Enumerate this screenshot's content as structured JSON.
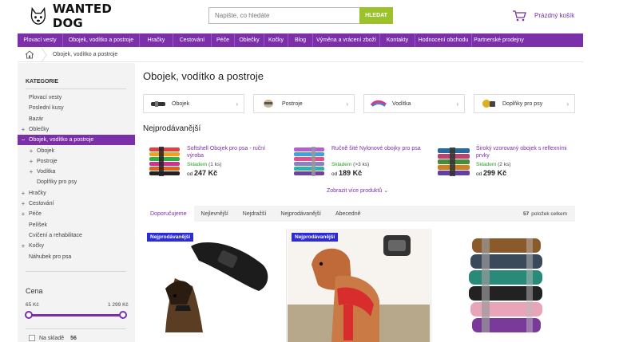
{
  "header": {
    "logo_text": "WANTED DOG",
    "search_placeholder": "Napište, co hledáte",
    "search_button": "HLEDAT",
    "cart_label": "Prázdný košík"
  },
  "nav": [
    "Plovací vesty",
    "Obojek, vodítko a postroje",
    "Hračky",
    "Cestování",
    "Péče",
    "Oblečky",
    "Kočky",
    "Blog",
    "Výměna a vrácení zboží",
    "Kontakty",
    "Hodnocení obchodu",
    "Partnerské prodejny"
  ],
  "breadcrumb": {
    "current": "Obojek, vodítko a postroje"
  },
  "sidebar": {
    "title": "KATEGORIE",
    "categories": [
      {
        "label": "Plovací vesty",
        "marker": "",
        "indent": 0
      },
      {
        "label": "Poslední kusy",
        "marker": "",
        "indent": 0
      },
      {
        "label": "Bazár",
        "marker": "",
        "indent": 0
      },
      {
        "label": "Oblečky",
        "marker": "+",
        "indent": 0
      },
      {
        "label": "Obojek, vodítko a postroje",
        "marker": "−",
        "indent": 0,
        "selected": true
      },
      {
        "label": "Obojek",
        "marker": "+",
        "indent": 1
      },
      {
        "label": "Postroje",
        "marker": "+",
        "indent": 1
      },
      {
        "label": "Vodítka",
        "marker": "+",
        "indent": 1
      },
      {
        "label": "Doplňky pro psy",
        "marker": "",
        "indent": 1
      },
      {
        "label": "Hračky",
        "marker": "+",
        "indent": 0
      },
      {
        "label": "Cestování",
        "marker": "+",
        "indent": 0
      },
      {
        "label": "Péče",
        "marker": "+",
        "indent": 0
      },
      {
        "label": "Pelíšek",
        "marker": "",
        "indent": 0
      },
      {
        "label": "Cvičení a rehabilitace",
        "marker": "",
        "indent": 0
      },
      {
        "label": "Kočky",
        "marker": "+",
        "indent": 0
      },
      {
        "label": "Náhubek pro psa",
        "marker": "",
        "indent": 0
      }
    ],
    "price": {
      "title": "Cena",
      "min_label": "65 Kč",
      "max_label": "1 299 Kč",
      "range_low": 0.0,
      "range_high": 1.0
    },
    "stock_filter": {
      "label": "Na skladě",
      "count": "56",
      "checked": false
    }
  },
  "main": {
    "title": "Obojek, vodítko a postroje",
    "subcategories": [
      {
        "label": "Obojek",
        "icon": "collar-thumbnail"
      },
      {
        "label": "Postroje",
        "icon": "harness-thumbnail"
      },
      {
        "label": "Vodítka",
        "icon": "leash-thumbnail"
      },
      {
        "label": "Doplňky pro psy",
        "icon": "accessories-thumbnail"
      }
    ],
    "bestsellers_title": "Nejprodávanější",
    "bestsellers": [
      {
        "name": "Softshell Obojek pro psa - ruční výroba",
        "stock": "Skladem",
        "qty": "(1 ks)",
        "price_prefix": "od",
        "price": "247 Kč"
      },
      {
        "name": "Ručně šité Nylonové obojky pro psa",
        "stock": "Skladem",
        "qty": "(>3 ks)",
        "price_prefix": "od",
        "price": "189 Kč"
      },
      {
        "name": "Široký vzorovaný obojek s reflexními prvky",
        "stock": "Skladem",
        "qty": "(2 ks)",
        "price_prefix": "od",
        "price": "299 Kč"
      }
    ],
    "more_link": "Zobrazit více produktů",
    "sort_tabs": [
      "Doporučujeme",
      "Nejlevnější",
      "Nejdražší",
      "Nejprodávanější",
      "Abecedně"
    ],
    "active_sort": "Doporučujeme",
    "total_count": "57",
    "total_label": "položek celkem",
    "products": [
      {
        "badge": "Nejprodávanější",
        "image": "black-tactical-collar-with-dog"
      },
      {
        "badge": "Nejprodávanější",
        "image": "dog-in-red-harness"
      },
      {
        "badge": "",
        "image": "stack-of-leather-collars"
      }
    ]
  },
  "colors": {
    "brand": "#7b2fa8",
    "search_button": "#9bc22b",
    "badge": "#2b2bd8",
    "in_stock": "#2a9d2a"
  }
}
